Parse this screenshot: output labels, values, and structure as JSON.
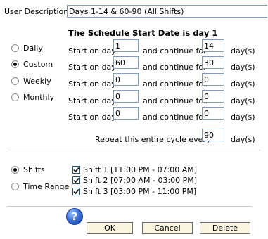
{
  "description": {
    "label": "User Description:",
    "value": "Days 1-14 & 60-90 (All Shifts)"
  },
  "schedule": {
    "title": "The Schedule Start Date is day 1",
    "frequency_options": [
      {
        "label": "Daily",
        "checked": false
      },
      {
        "label": "Custom",
        "checked": true
      },
      {
        "label": "Weekly",
        "checked": false
      },
      {
        "label": "Monthly",
        "checked": false
      }
    ],
    "start_label": "Start on day",
    "continue_label": "and continue for",
    "unit_label": "day(s)",
    "rows": [
      {
        "start": "1",
        "continue": "14"
      },
      {
        "start": "60",
        "continue": "30"
      },
      {
        "start": "0",
        "continue": "0"
      },
      {
        "start": "0",
        "continue": "0"
      },
      {
        "start": "0",
        "continue": "0"
      }
    ],
    "repeat_label": "Repeat this entire cycle every",
    "repeat_value": "90",
    "repeat_unit": "day(s)"
  },
  "shift_mode": {
    "options": [
      {
        "label": "Shifts",
        "checked": true
      },
      {
        "label": "Time Range",
        "checked": false
      }
    ],
    "shifts": [
      {
        "label": "Shift 1 [11:00 PM - 07:00 AM]",
        "checked": true
      },
      {
        "label": "Shift 2 [07:00 AM - 03:00 PM]",
        "checked": true
      },
      {
        "label": "Shift 3 [03:00 PM - 11:00 PM]",
        "checked": true
      }
    ]
  },
  "buttons": {
    "help": "?",
    "ok": "OK",
    "cancel": "Cancel",
    "delete": "Delete"
  }
}
